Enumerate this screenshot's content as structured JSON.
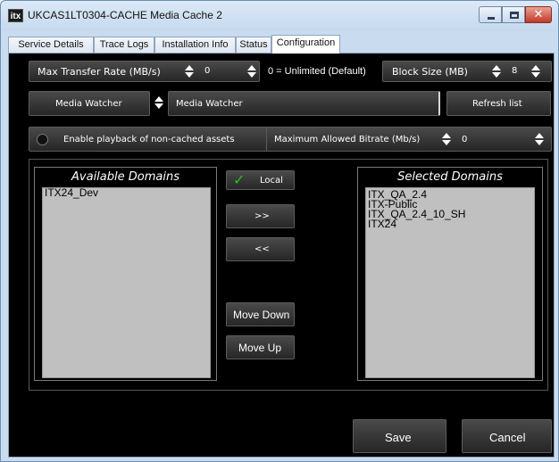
{
  "window": {
    "app_icon_text": "itx",
    "title": "UKCAS1LT0304-CACHE Media Cache 2"
  },
  "tabs": [
    "Service Details",
    "Trace Logs",
    "Installation Info",
    "Status",
    "Configuration"
  ],
  "active_tab": "Configuration",
  "config": {
    "max_transfer_rate_label": "Max Transfer Rate (MB/s)",
    "max_transfer_rate_value": "0",
    "unlimited_note": "0 = Unlimited (Default)",
    "block_size_label": "Block Size (MB)",
    "block_size_value": "8",
    "media_watcher_button": "Media Watcher",
    "media_watcher_value": "Media Watcher",
    "refresh_list_button": "Refresh list",
    "enable_playback_label": "Enable playback of non-cached assets",
    "max_bitrate_label": "Maximum Allowed Bitrate (Mb/s)",
    "max_bitrate_value": "0"
  },
  "available_domains": {
    "title": "Available Domains",
    "items": [
      "ITX24_Dev"
    ]
  },
  "selected_domains": {
    "title": "Selected Domains",
    "items": [
      "ITX_QA_2.4",
      "ITX-Public",
      "ITX_QA_2.4_10_SH",
      "ITX24"
    ]
  },
  "domain_actions": {
    "local_label": "Local",
    "add_label": ">>",
    "remove_label": "<<",
    "move_down_label": "Move Down",
    "move_up_label": "Move Up"
  },
  "footer": {
    "save_label": "Save",
    "cancel_label": "Cancel"
  },
  "colors": {
    "panel_background": "#000000",
    "list_background": "#c0c0c0",
    "check_green": "#22c322"
  }
}
